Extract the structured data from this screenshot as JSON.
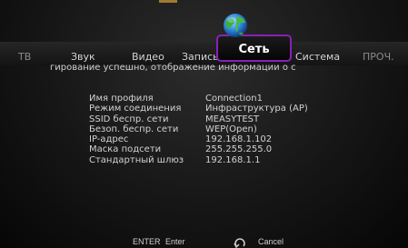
{
  "tabs": [
    {
      "label": "ТВ",
      "active": false
    },
    {
      "label": "Звук",
      "active": false
    },
    {
      "label": "Видео",
      "active": false
    },
    {
      "label": "Запись",
      "active": false
    },
    {
      "label": "Сеть",
      "active": true
    },
    {
      "label": "Система",
      "active": false
    },
    {
      "label": "ПРОЧ.",
      "active": false
    }
  ],
  "status_message": "гирование успешно, отображение информации о с",
  "network_info": [
    {
      "label": "Имя профиля",
      "value": "Connection1"
    },
    {
      "label": "Режим соединения",
      "value": "Инфраструктура (AP)"
    },
    {
      "label": "SSID беспр. сети",
      "value": "MEASYTEST"
    },
    {
      "label": "Безоп. беспр. сети",
      "value": "WEP(Open)"
    },
    {
      "label": "IP-адрес",
      "value": "192.168.1.102"
    },
    {
      "label": "Маска подсети",
      "value": "255.255.255.0"
    },
    {
      "label": "Стандартный шлюз",
      "value": "192.168.1.1"
    }
  ],
  "footer": {
    "enter_key": "ENTER",
    "enter_label": "Enter",
    "cancel_label": "Cancel",
    "cancel_icon": "return-arrow-icon"
  },
  "icons": {
    "active_tab_icon": "globe-icon"
  },
  "colors": {
    "accent": "#8a20b8",
    "text": "#d2d2d2",
    "background": "#141414"
  }
}
